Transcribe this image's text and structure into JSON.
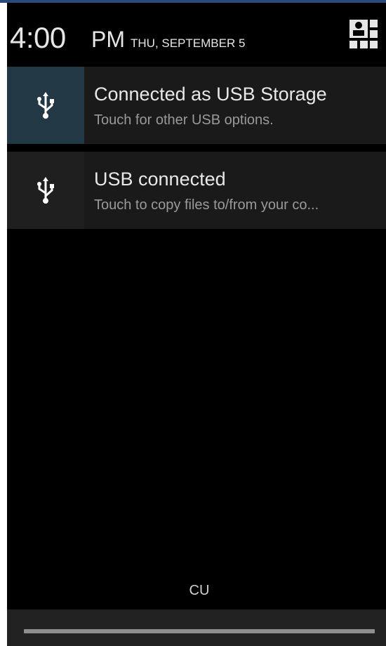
{
  "status_header": {
    "time": "4:00",
    "ampm": "PM",
    "date": "THU, SEPTEMBER 5",
    "settings_icon": "quick-settings-icon"
  },
  "notifications": [
    {
      "icon": "usb-icon",
      "title": "Connected as USB Storage",
      "subtitle": "Touch for other USB options."
    },
    {
      "icon": "usb-icon",
      "title": "USB connected",
      "subtitle": "Touch to copy files to/from your co..."
    }
  ],
  "carrier_label": "CU",
  "colors": {
    "background": "#000000",
    "notification_bg": "#1a1a1a",
    "highlight_icon_bg": "#223844",
    "text_primary": "#e8e8e8",
    "text_secondary": "#9a9a9a"
  }
}
